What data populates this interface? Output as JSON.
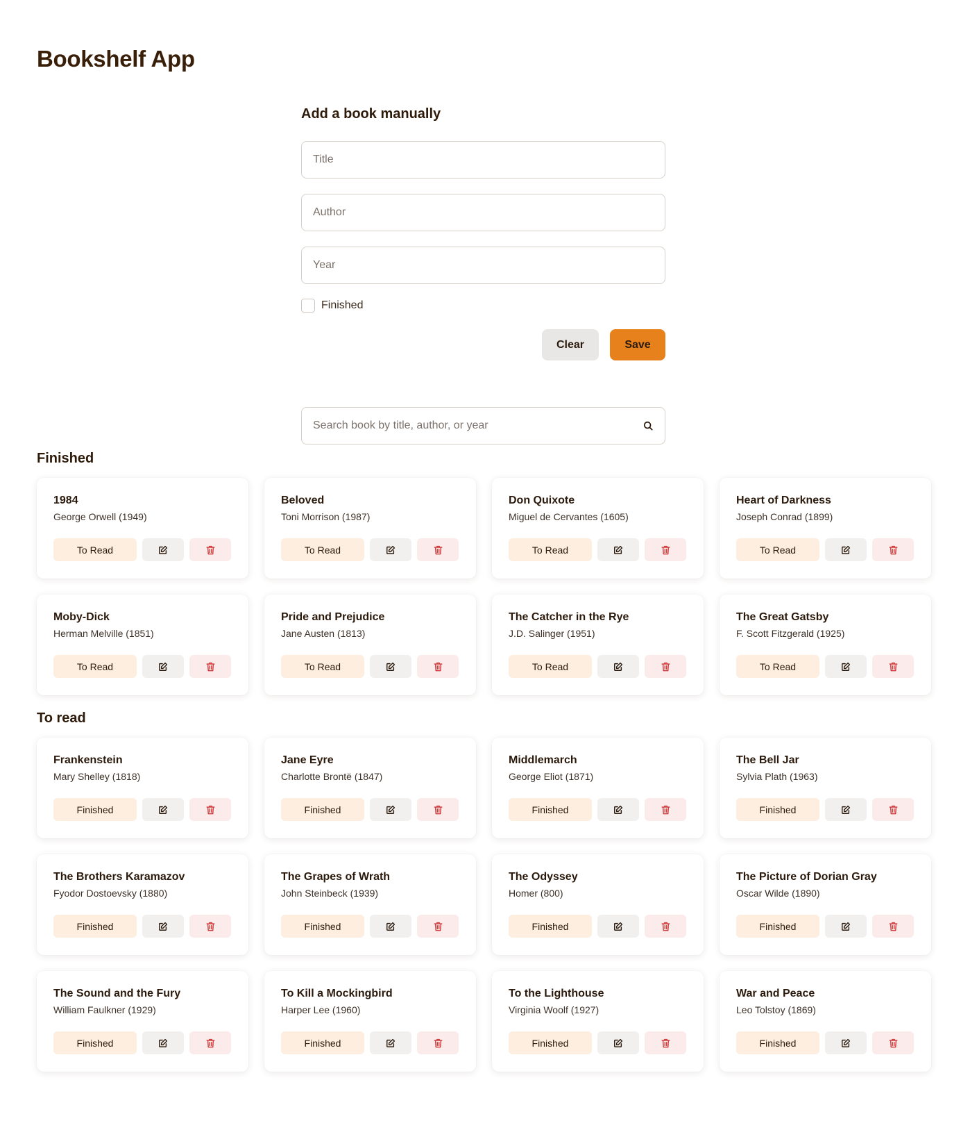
{
  "app": {
    "title": "Bookshelf App"
  },
  "form": {
    "title": "Add a book manually",
    "title_placeholder": "Title",
    "author_placeholder": "Author",
    "year_placeholder": "Year",
    "finished_label": "Finished",
    "finished_checked": false,
    "clear_label": "Clear",
    "save_label": "Save"
  },
  "search": {
    "placeholder": "Search book by title, author, or year",
    "icon": "search-icon"
  },
  "colors": {
    "accent": "#e6811c",
    "title": "#3a1f08",
    "status_bg": "#fdeee0",
    "delete_icon": "#d03b3b"
  },
  "finished_section": {
    "title": "Finished",
    "action_label": "To Read",
    "books": [
      {
        "title": "1984",
        "author": "George Orwell",
        "year": "1949",
        "meta": "George Orwell (1949)"
      },
      {
        "title": "Beloved",
        "author": "Toni Morrison",
        "year": "1987",
        "meta": "Toni Morrison (1987)"
      },
      {
        "title": "Don Quixote",
        "author": "Miguel de Cervantes",
        "year": "1605",
        "meta": "Miguel de Cervantes (1605)"
      },
      {
        "title": "Heart of Darkness",
        "author": "Joseph Conrad",
        "year": "1899",
        "meta": "Joseph Conrad (1899)"
      },
      {
        "title": "Moby-Dick",
        "author": "Herman Melville",
        "year": "1851",
        "meta": "Herman Melville (1851)"
      },
      {
        "title": "Pride and Prejudice",
        "author": "Jane Austen",
        "year": "1813",
        "meta": "Jane Austen (1813)"
      },
      {
        "title": "The Catcher in the Rye",
        "author": "J.D. Salinger",
        "year": "1951",
        "meta": "J.D. Salinger (1951)"
      },
      {
        "title": "The Great Gatsby",
        "author": "F. Scott Fitzgerald",
        "year": "1925",
        "meta": "F. Scott Fitzgerald (1925)"
      }
    ]
  },
  "to_read_section": {
    "title": "To read",
    "action_label": "Finished",
    "books": [
      {
        "title": "Frankenstein",
        "author": "Mary Shelley",
        "year": "1818",
        "meta": "Mary Shelley (1818)"
      },
      {
        "title": "Jane Eyre",
        "author": "Charlotte Brontë",
        "year": "1847",
        "meta": "Charlotte Brontë (1847)"
      },
      {
        "title": "Middlemarch",
        "author": "George Eliot",
        "year": "1871",
        "meta": "George Eliot (1871)"
      },
      {
        "title": "The Bell Jar",
        "author": "Sylvia Plath",
        "year": "1963",
        "meta": "Sylvia Plath (1963)"
      },
      {
        "title": "The Brothers Karamazov",
        "author": "Fyodor Dostoevsky",
        "year": "1880",
        "meta": "Fyodor Dostoevsky (1880)"
      },
      {
        "title": "The Grapes of Wrath",
        "author": "John Steinbeck",
        "year": "1939",
        "meta": "John Steinbeck (1939)"
      },
      {
        "title": "The Odyssey",
        "author": "Homer",
        "year": "800",
        "meta": "Homer (800)"
      },
      {
        "title": "The Picture of Dorian Gray",
        "author": "Oscar Wilde",
        "year": "1890",
        "meta": "Oscar Wilde (1890)"
      },
      {
        "title": "The Sound and the Fury",
        "author": "William Faulkner",
        "year": "1929",
        "meta": "William Faulkner (1929)"
      },
      {
        "title": "To Kill a Mockingbird",
        "author": "Harper Lee",
        "year": "1960",
        "meta": "Harper Lee (1960)"
      },
      {
        "title": "To the Lighthouse",
        "author": "Virginia Woolf",
        "year": "1927",
        "meta": "Virginia Woolf (1927)"
      },
      {
        "title": "War and Peace",
        "author": "Leo Tolstoy",
        "year": "1869",
        "meta": "Leo Tolstoy (1869)"
      }
    ]
  }
}
